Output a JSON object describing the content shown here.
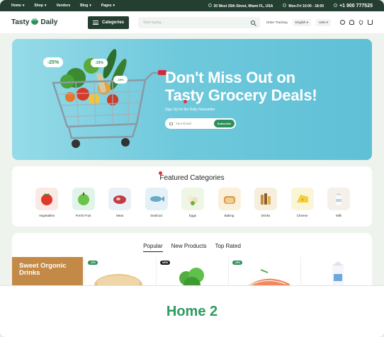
{
  "topbar": {
    "nav": [
      "Home",
      "Shop",
      "Vendors",
      "Blog",
      "Pages"
    ],
    "address": "20 West 25th Street, Miami FL, USA",
    "hours": "Mon-Fri 10:00 - 18:00",
    "phone": "+1 900 777525"
  },
  "header": {
    "logo_left": "Tasty",
    "logo_right": "Daily",
    "categories_label": "Categories",
    "search_placeholder": "Start typing...",
    "order_tracking": "Order Tracking",
    "language": "English",
    "currency": "USD"
  },
  "hero": {
    "title_line1": "Don't Miss Out on",
    "title_line2": "Tasty Grocery Deals!",
    "subtitle": "Sign Up for the Daily Newsletter",
    "email_placeholder": "Your Email",
    "subscribe_label": "Subscribe",
    "badges": [
      "-25%",
      "-33%",
      "-15%"
    ]
  },
  "featured": {
    "title": "Featured Categories",
    "items": [
      {
        "label": "Vegetables",
        "icon": "tomato-icon",
        "bg": "#fbe9e5"
      },
      {
        "label": "Fresh Fruit",
        "icon": "apple-icon",
        "bg": "#e2f3ea"
      },
      {
        "label": "Meat",
        "icon": "meat-icon",
        "bg": "#eaf1f6"
      },
      {
        "label": "Seafood",
        "icon": "fish-icon",
        "bg": "#e4f1f7"
      },
      {
        "label": "Eggs",
        "icon": "eggs-icon",
        "bg": "#eef7e5"
      },
      {
        "label": "Baking",
        "icon": "bread-icon",
        "bg": "#fbf0dc"
      },
      {
        "label": "Drinks",
        "icon": "drinks-icon",
        "bg": "#f7efde"
      },
      {
        "label": "Cheese",
        "icon": "cheese-icon",
        "bg": "#fbf5d8"
      },
      {
        "label": "Milk",
        "icon": "milk-icon",
        "bg": "#f6f0ea"
      }
    ]
  },
  "products": {
    "tabs": [
      "Popular",
      "New Products",
      "Top Rated"
    ],
    "promo_title": "Sweet Orgonic Drinks",
    "tags": [
      "-15%",
      "NEW",
      "-25%"
    ]
  },
  "caption": "Home 2",
  "colors": {
    "brand": "#243f31",
    "accent": "#2f8f5b",
    "hero": "#6fc9dc",
    "caption": "#2f9a60"
  }
}
